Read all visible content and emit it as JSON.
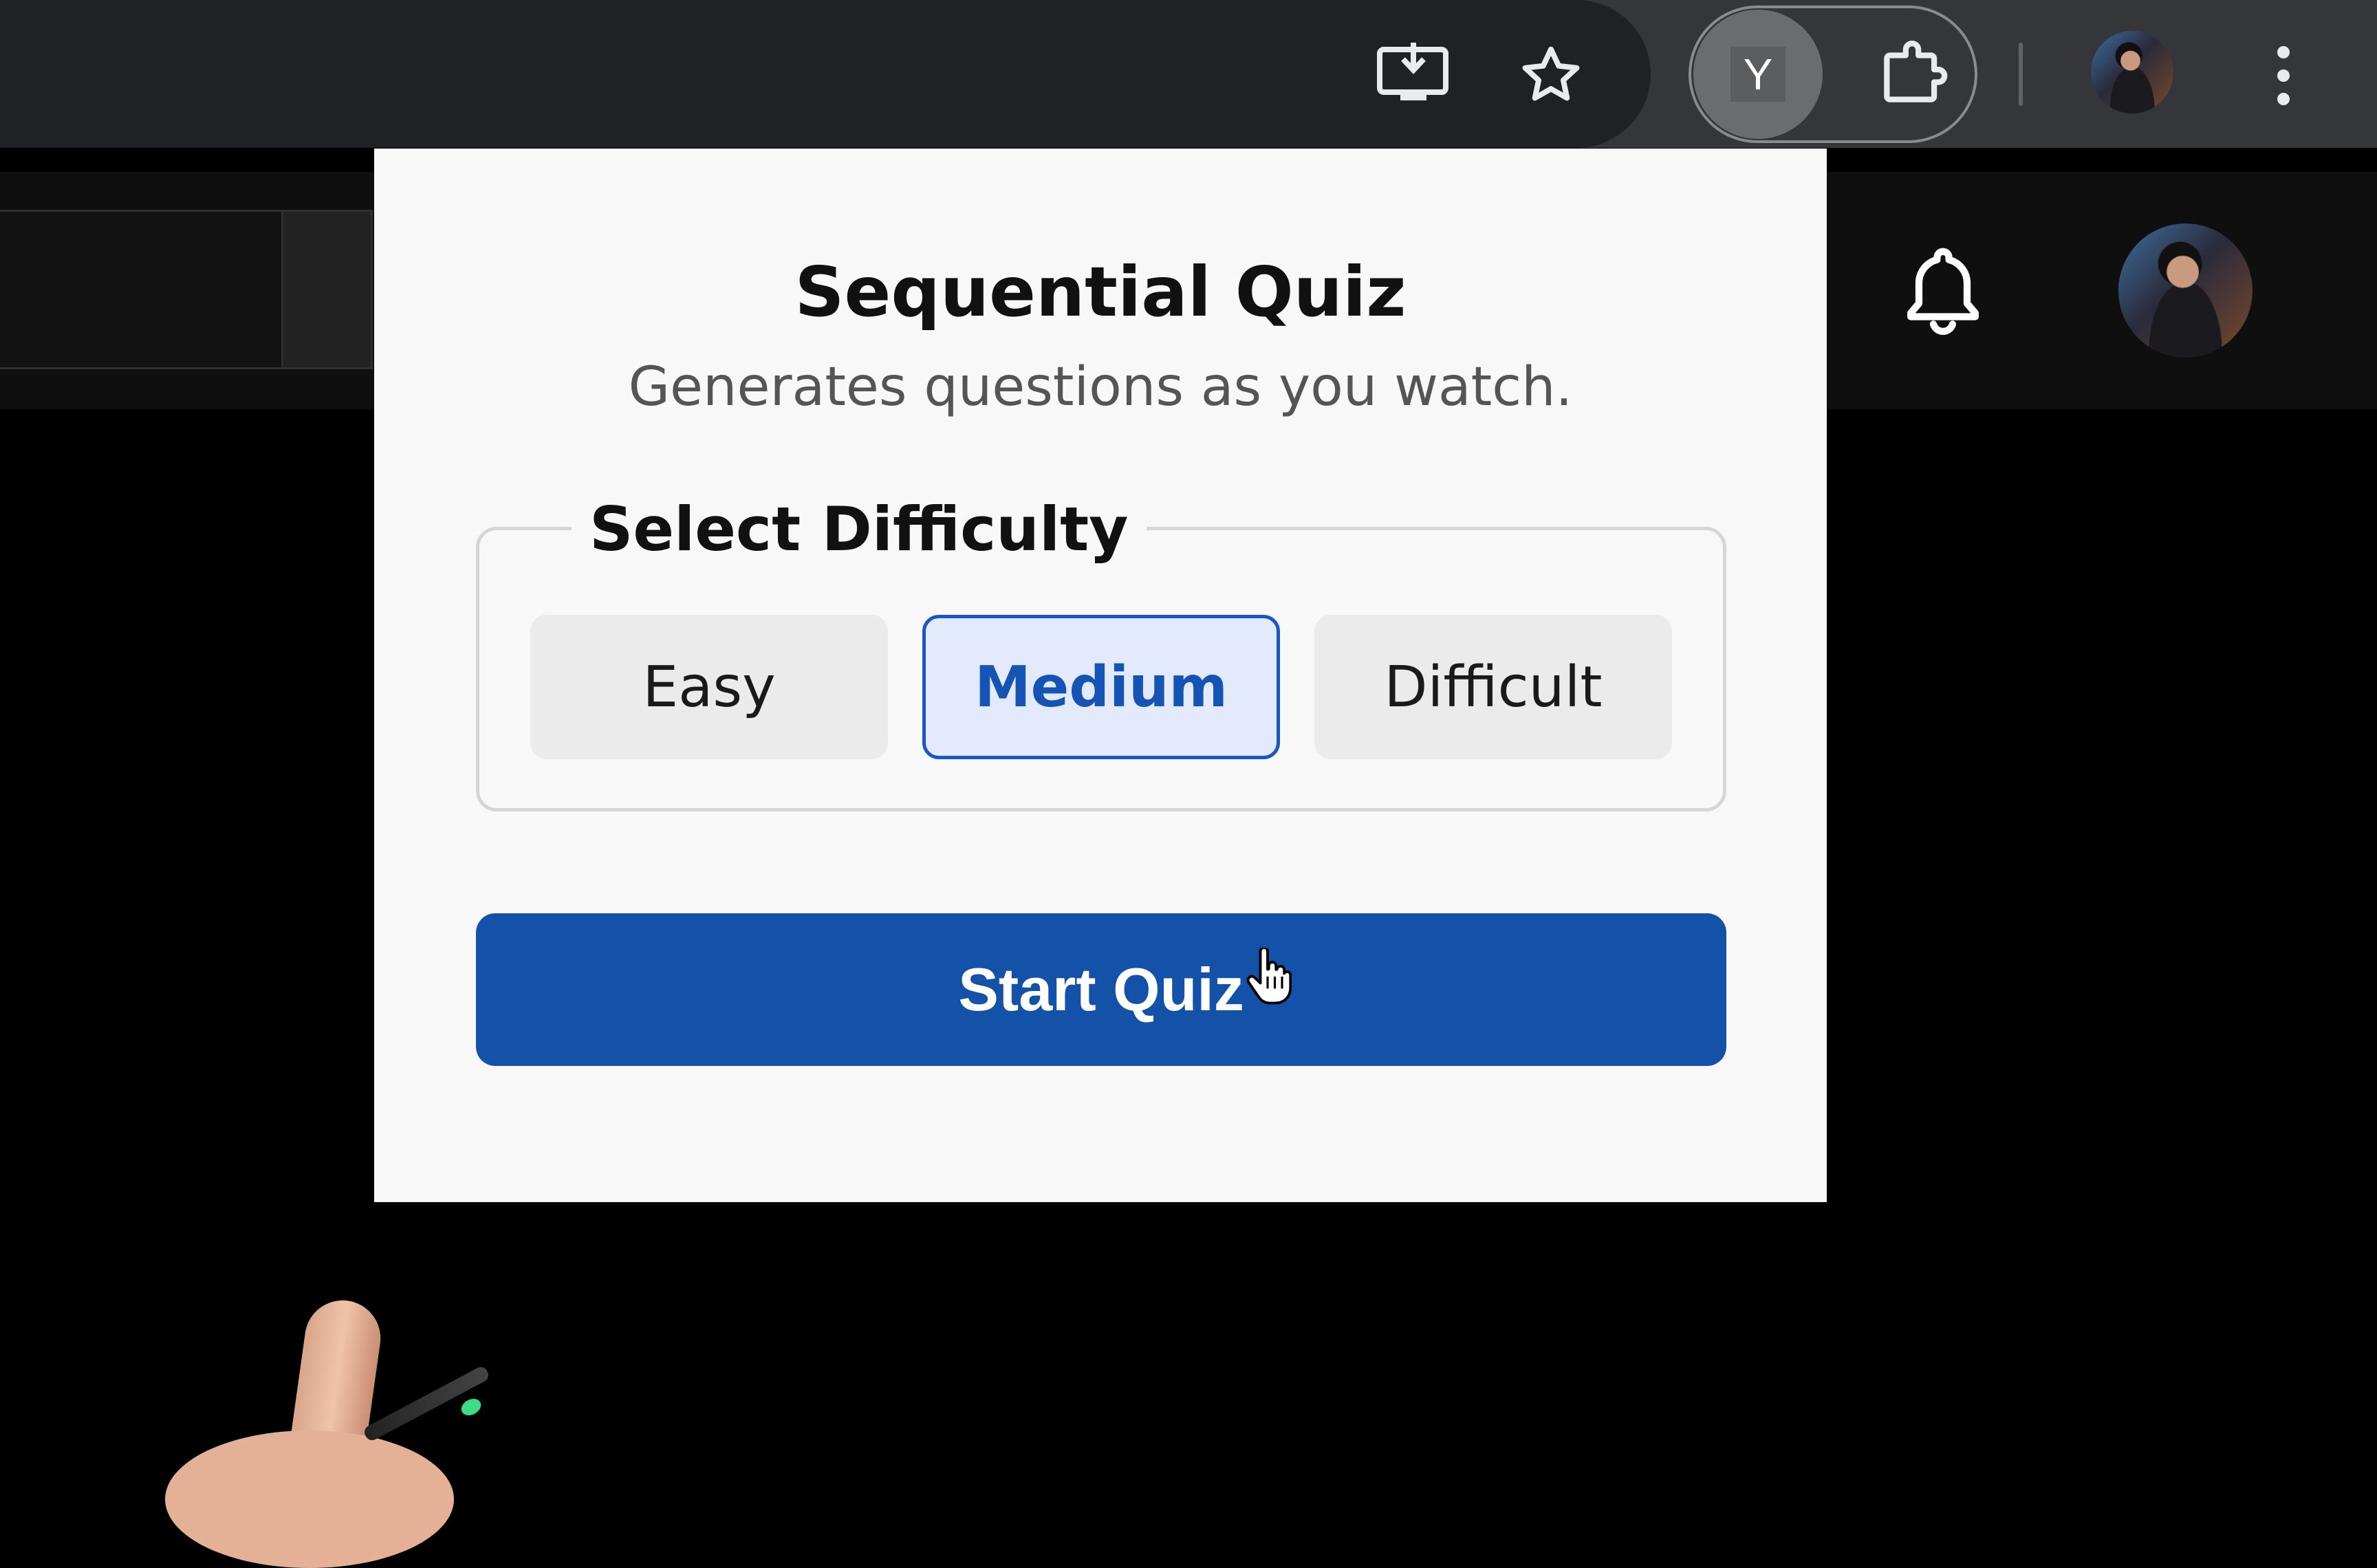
{
  "popup": {
    "title": "Sequential Quiz",
    "subtitle": "Generates questions as you watch.",
    "difficulty": {
      "legend": "Select Difficulty",
      "options": [
        {
          "label": "Easy",
          "selected": false
        },
        {
          "label": "Medium",
          "selected": true
        },
        {
          "label": "Difficult",
          "selected": false
        }
      ]
    },
    "start_label": "Start Quiz"
  },
  "toolbar": {
    "icons": [
      "install-app-icon",
      "bookmark-star-icon",
      "extension-y-icon",
      "puzzle-icon",
      "profile-avatar",
      "kebab-menu-icon"
    ],
    "active_extension_letter": "Y"
  },
  "page": {
    "icons": [
      "notification-bell-icon",
      "channel-avatar"
    ]
  },
  "colors": {
    "accent": "#1352a8",
    "selected_bg": "#e3eafd",
    "selected_border": "#1a56c4",
    "popup_bg": "#f8f8f8",
    "toolbar_bg": "#35363a"
  }
}
